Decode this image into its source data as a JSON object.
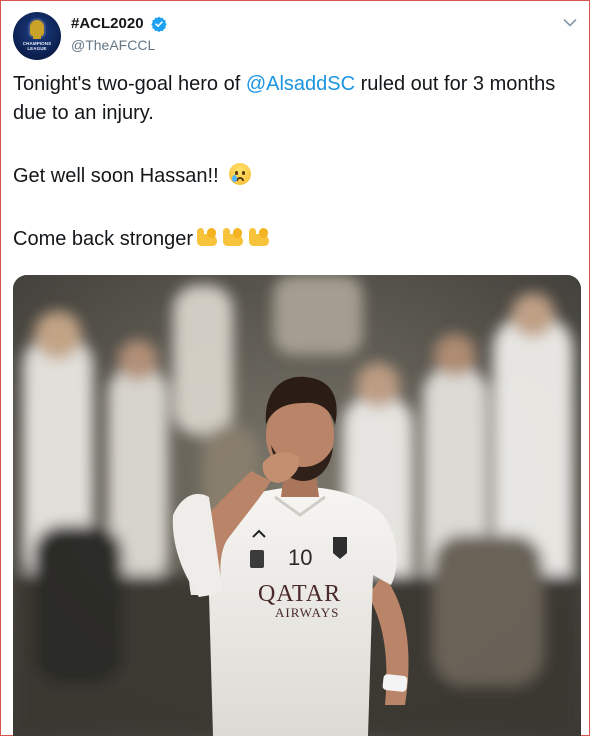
{
  "account": {
    "display_name": "#ACL2020",
    "handle": "@TheAFCCL",
    "avatar_text": "CHAMPIONS LEAGUE"
  },
  "tweet": {
    "line1_before": "Tonight's two-goal hero of ",
    "mention": "@AlsaddSC",
    "line1_after": " ruled out for 3 months due to an injury.",
    "line2": "Get well soon Hassan!!",
    "line3": "Come back stronger"
  },
  "photo": {
    "jersey_number": "10",
    "sponsor_line1": "QATAR",
    "sponsor_line2": "AIRWAYS"
  },
  "icons": {
    "verified": "verified-badge-icon",
    "menu": "chevron-down-icon",
    "cry_emoji": "crying-face-emoji",
    "arm_emoji": "flexed-biceps-emoji"
  },
  "colors": {
    "link": "#1b95e0",
    "verified": "#1da1f2",
    "frame": "#d9534f"
  }
}
